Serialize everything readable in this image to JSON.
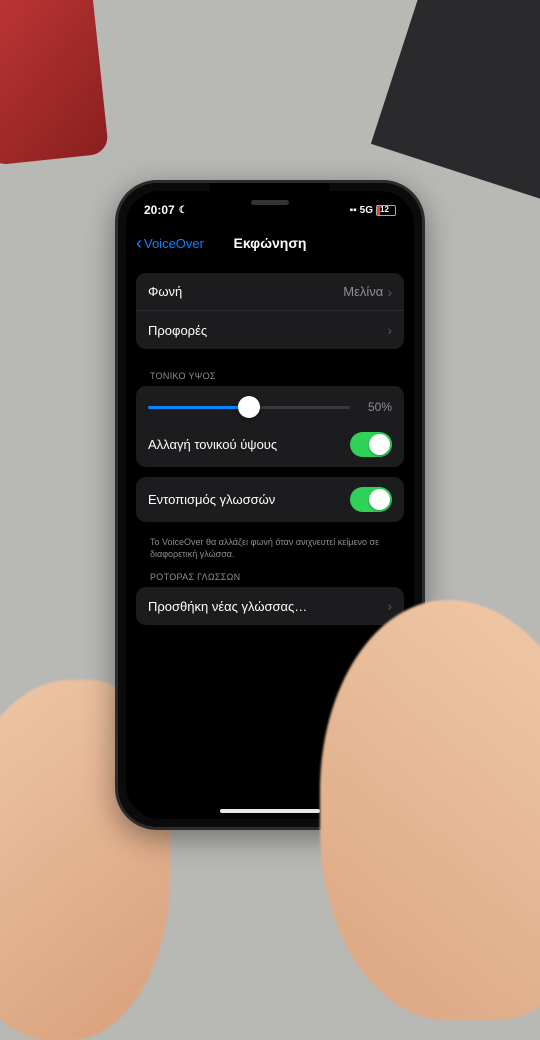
{
  "status": {
    "time": "20:07",
    "network": "5G",
    "battery_level": "12"
  },
  "nav": {
    "back_label": "VoiceOver",
    "title": "Εκφώνηση"
  },
  "voice_group": {
    "voice_label": "Φωνή",
    "voice_value": "Μελίνα",
    "accents_label": "Προφορές"
  },
  "pitch_group": {
    "header": "ΤΟΝΙΚΟ ΥΨΟΣ",
    "percent": "50%",
    "change_label": "Αλλαγή τονικού ύψους"
  },
  "detect_group": {
    "label": "Εντοπισμός γλωσσών",
    "footer": "Το VoiceOver θα αλλάζει φωνή όταν ανιχνευτεί κείμενο σε διαφορετική γλώσσα."
  },
  "rotor_group": {
    "header": "ΡΟΤΟΡΑΣ ΓΛΩΣΣΩΝ",
    "add_label": "Προσθήκη νέας γλώσσας…"
  }
}
